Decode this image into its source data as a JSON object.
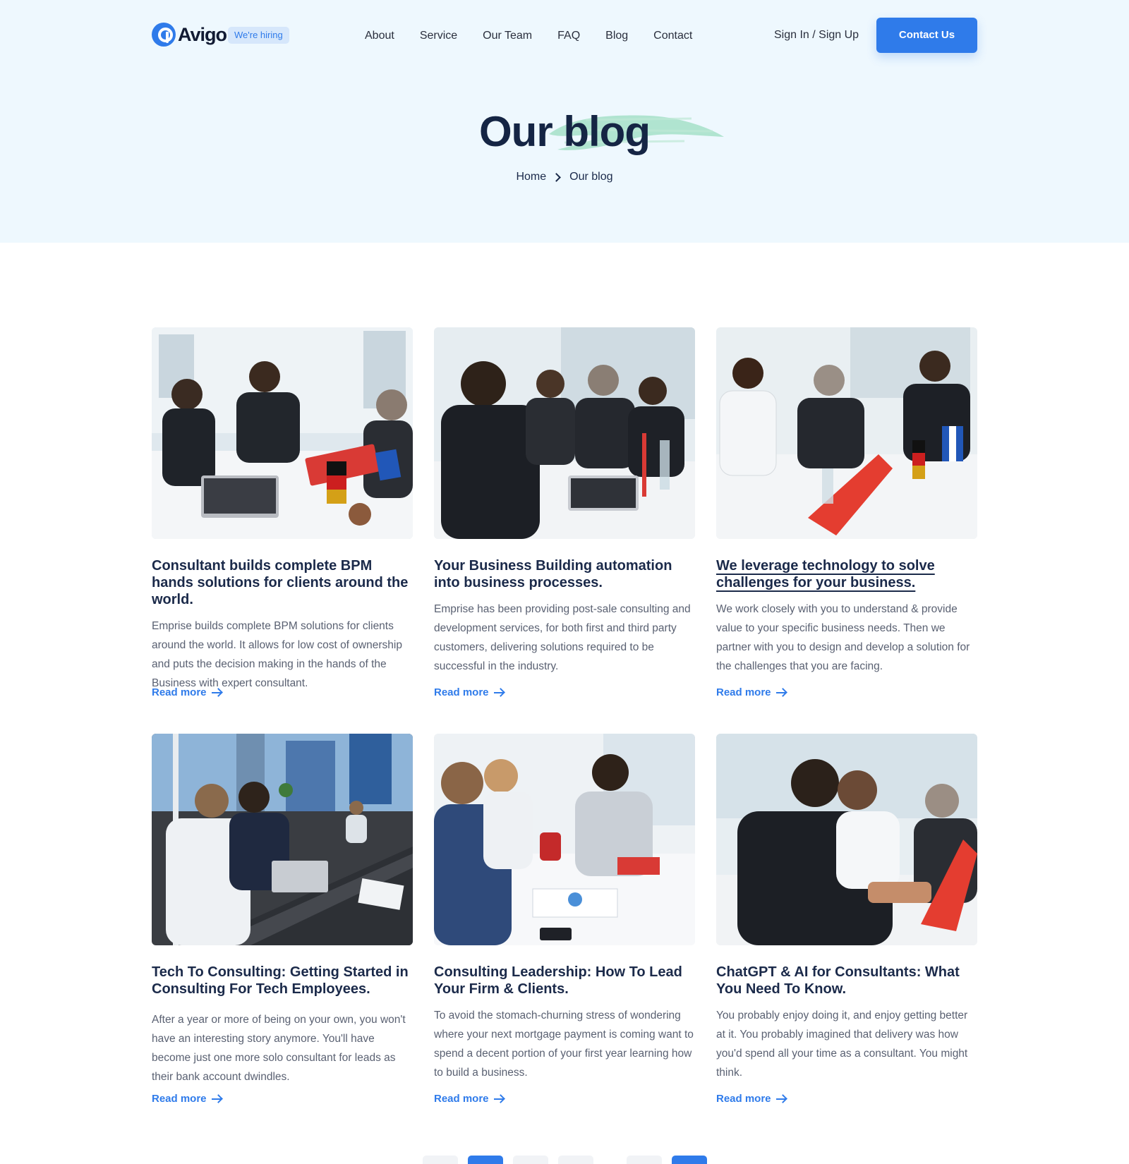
{
  "header": {
    "logo_text": "Avigo",
    "hiring_badge": "We're hiring",
    "nav": [
      "About",
      "Service",
      "Our Team",
      "FAQ",
      "Blog",
      "Contact"
    ],
    "signin": "Sign In / Sign Up",
    "contact_button": "Contact Us"
  },
  "hero": {
    "title": "Our blog",
    "breadcrumb": [
      "Home",
      "Our blog"
    ],
    "brush_color": "#a5e1c8"
  },
  "posts": [
    {
      "title": "Consultant builds complete BPM hands solutions for clients around the world.",
      "excerpt": "Emprise builds complete BPM solutions for clients around the world. It allows for low cost of ownership and puts the decision making in the hands of the Business with expert consultant.",
      "read_more": "Read more"
    },
    {
      "title": "Your Business Building automation into business processes.",
      "excerpt": "Emprise has been providing post-sale consulting and development services, for both first and third party customers, delivering solutions required to be successful in the industry.",
      "read_more": "Read more"
    },
    {
      "title": "We leverage technology to solve challenges for your business.",
      "excerpt": "We work closely with you to understand & provide value to your specific business needs. Then we partner with you to design and develop a solution for the challenges that you are facing.",
      "read_more": "Read more"
    },
    {
      "title": "Tech To Consulting: Getting Started in Consulting For Tech Employees.",
      "excerpt": "After a year or more of being on your own, you won't have an interesting story anymore. You'll have become just one more solo consultant   for leads as their bank account dwindles.",
      "read_more": "Read more"
    },
    {
      "title": "Consulting Leadership: How To Lead Your Firm & Clients.",
      "excerpt": "To avoid the stomach-churning stress of wondering where your next mortgage payment is coming  want to spend a decent portion of your first year learning how to build a business.",
      "read_more": "Read more"
    },
    {
      "title": "ChatGPT & AI for Consultants: What You Need To Know.",
      "excerpt": "You probably enjoy doing it, and enjoy getting better at it. You probably imagined that delivery was how you'd spend all your time as a consultant. You might think.",
      "read_more": "Read more"
    }
  ],
  "colors": {
    "accent": "#2f7bea",
    "hero_bg": "#eef8fe",
    "heading": "#1b2a4a",
    "body_text": "#5a6172"
  },
  "icons": [
    "logo-mark-icon",
    "chevron-right-icon",
    "arrow-right-icon"
  ]
}
